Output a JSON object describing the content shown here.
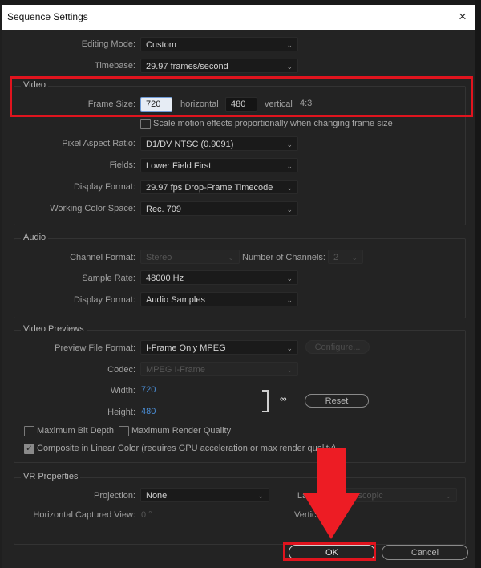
{
  "window": {
    "title": "Sequence Settings",
    "close_icon": "×"
  },
  "general": {
    "editing_mode": {
      "label": "Editing Mode:",
      "value": "Custom"
    },
    "timebase": {
      "label": "Timebase:",
      "value": "29.97  frames/second"
    }
  },
  "video": {
    "legend": "Video",
    "frame_size_label": "Frame Size:",
    "horizontal_value": "720",
    "horizontal_label": "horizontal",
    "vertical_value": "480",
    "vertical_label": "vertical",
    "aspect": "4:3",
    "scale_checkbox": {
      "label": "Scale motion effects proportionally when changing frame size",
      "checked": false
    },
    "pixel_aspect_ratio": {
      "label": "Pixel Aspect Ratio:",
      "value": "D1/DV NTSC (0.9091)"
    },
    "fields": {
      "label": "Fields:",
      "value": "Lower Field First"
    },
    "display_format": {
      "label": "Display Format:",
      "value": "29.97 fps Drop-Frame Timecode"
    },
    "working_color_space": {
      "label": "Working Color Space:",
      "value": "Rec. 709"
    }
  },
  "audio": {
    "legend": "Audio",
    "channel_format": {
      "label": "Channel Format:",
      "value": "Stereo"
    },
    "number_of_channels": {
      "label": "Number of Channels:",
      "value": "2"
    },
    "sample_rate": {
      "label": "Sample Rate:",
      "value": "48000 Hz"
    },
    "display_format": {
      "label": "Display Format:",
      "value": "Audio Samples"
    }
  },
  "video_previews": {
    "legend": "Video Previews",
    "preview_file_format": {
      "label": "Preview File Format:",
      "value": "I-Frame Only MPEG"
    },
    "configure_label": "Configure...",
    "codec": {
      "label": "Codec:",
      "value": "MPEG I-Frame"
    },
    "width": {
      "label": "Width:",
      "value": "720"
    },
    "height": {
      "label": "Height:",
      "value": "480"
    },
    "reset_label": "Reset",
    "max_bit_depth": {
      "label": "Maximum Bit Depth",
      "checked": false
    },
    "max_render_quality": {
      "label": "Maximum Render Quality",
      "checked": false
    },
    "composite_linear": {
      "label": "Composite in Linear Color (requires GPU acceleration or max render quality)",
      "checked": true
    }
  },
  "vr": {
    "legend": "VR Properties",
    "projection": {
      "label": "Projection:",
      "value": "None"
    },
    "layout": {
      "label": "Layout:",
      "value": "Monoscopic"
    },
    "horizontal_captured_view": {
      "label": "Horizontal Captured View:",
      "value": "0 °"
    },
    "vertical_label": "Vertical:"
  },
  "footer": {
    "ok_label": "OK",
    "cancel_label": "Cancel"
  },
  "annotations": {
    "highlight_color": "#e0141e"
  }
}
